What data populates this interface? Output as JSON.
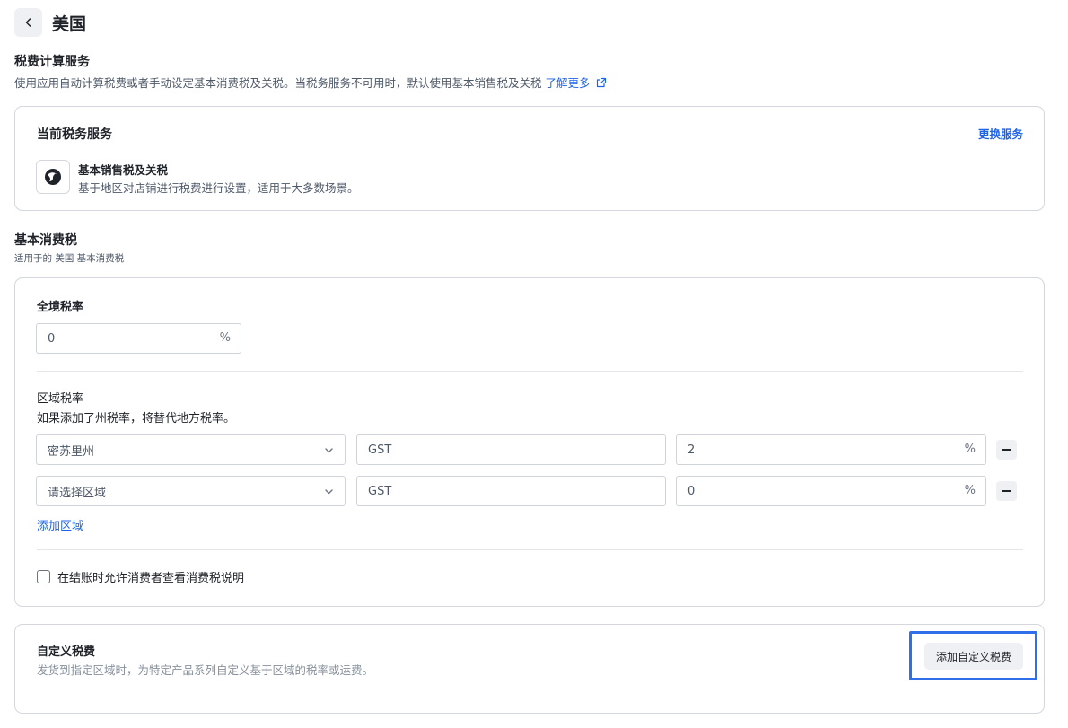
{
  "header": {
    "title": "美国"
  },
  "tax_service": {
    "title": "税费计算服务",
    "desc": "使用应用自动计算税费或者手动设定基本消费税及关税。当税务服务不可用时，默认使用基本销售税及关税",
    "learn_more": "了解更多",
    "card": {
      "title": "当前税务服务",
      "change_label": "更换服务",
      "service_name": "基本销售税及关税",
      "service_desc": "基于地区对店铺进行税费进行设置，适用于大多数场景。"
    }
  },
  "basic_tax": {
    "title": "基本消费税",
    "desc": "适用于的 美国 基本消费税",
    "national": {
      "label": "全境税率",
      "value": "0",
      "suffix": "%"
    },
    "regional": {
      "label": "区域税率",
      "desc": "如果添加了州税率，将替代地方税率。",
      "rows": [
        {
          "region": "密苏里州",
          "tax_name": "GST",
          "rate": "2",
          "suffix": "%"
        },
        {
          "region": "请选择区域",
          "tax_name": "GST",
          "rate": "0",
          "suffix": "%"
        }
      ],
      "add_label": "添加区域"
    },
    "checkbox_label": "在结账时允许消费者查看消费税说明"
  },
  "custom_tax": {
    "title": "自定义税费",
    "desc": "发货到指定区域时，为特定产品系列自定义基于区域的税率或运费。",
    "button_label": "添加自定义税费"
  },
  "colors": {
    "accent": "#1f63e8",
    "highlight": "#2f6fea"
  }
}
